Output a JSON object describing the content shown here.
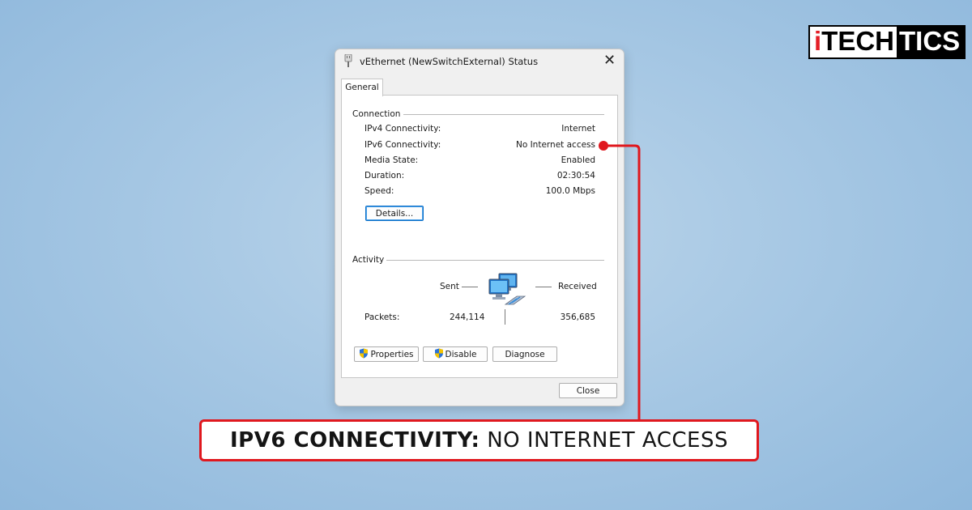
{
  "brand": {
    "logo_part1_red": "i",
    "logo_part1": "TECH",
    "logo_part2": "TICS"
  },
  "dialog": {
    "title": "vEthernet (NewSwitchExternal) Status",
    "close_glyph": "✕",
    "tab": "General",
    "connection": {
      "heading": "Connection",
      "rows": [
        {
          "label": "IPv4 Connectivity:",
          "value": "Internet"
        },
        {
          "label": "IPv6 Connectivity:",
          "value": "No Internet access"
        },
        {
          "label": "Media State:",
          "value": "Enabled"
        },
        {
          "label": "Duration:",
          "value": "02:30:54"
        },
        {
          "label": "Speed:",
          "value": "100.0 Mbps"
        }
      ],
      "details_button": "Details..."
    },
    "activity": {
      "heading": "Activity",
      "sent_label": "Sent",
      "received_label": "Received",
      "packets_label": "Packets:",
      "packets_sent": "244,114",
      "packets_received": "356,685"
    },
    "buttons": {
      "properties": "Properties",
      "disable": "Disable",
      "diagnose": "Diagnose",
      "close": "Close"
    }
  },
  "callout": {
    "bold_text": "IPV6 CONNECTIVITY:",
    "regular_text": " NO INTERNET ACCESS"
  },
  "colors": {
    "accent_red": "#e0181e",
    "dialog_bg": "#f0f0f0",
    "button_focus": "#0b6fc8"
  },
  "icons": [
    "network-adapter-icon",
    "close-icon",
    "uac-shield-icon",
    "network-computers-icon"
  ]
}
